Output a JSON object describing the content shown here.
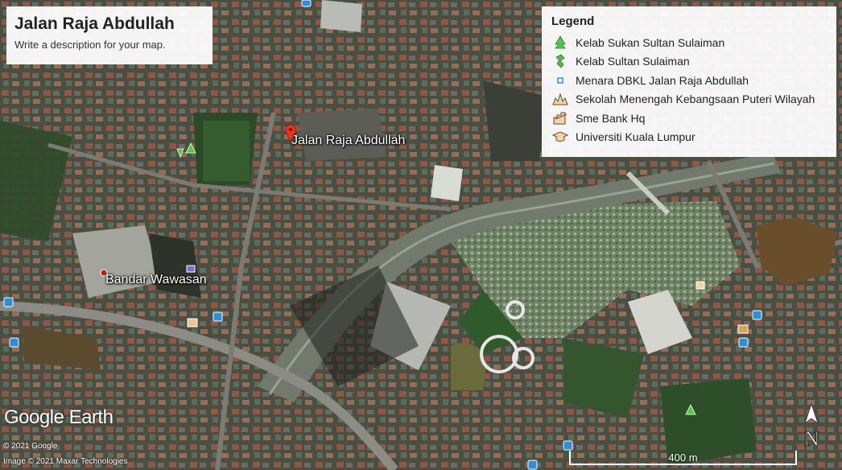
{
  "title": "Jalan Raja Abdullah",
  "description": "Write a description for your map.",
  "legend": {
    "heading": "Legend",
    "items": [
      {
        "label": "Kelab Sukan Sultan Sulaiman",
        "icon": "tree-icon"
      },
      {
        "label": "Kelab Sultan Sulaiman",
        "icon": "sports-icon"
      },
      {
        "label": "Menara DBKL Jalan Raja Abdullah",
        "icon": "square-marker-icon"
      },
      {
        "label": "Sekolah Menengah Kebangsaan Puteri Wilayah",
        "icon": "school-icon"
      },
      {
        "label": "Sme Bank Hq",
        "icon": "bank-icon"
      },
      {
        "label": "Universiti Kuala Lumpur",
        "icon": "graduation-cap-icon"
      }
    ]
  },
  "places": {
    "main_pin": "Jalan Raja Abdullah",
    "second_pin": "Bandar Wawasan"
  },
  "brand": {
    "google": "Google",
    "earth": "Earth"
  },
  "credits": {
    "line1": "© 2021 Google",
    "line2": "Image © 2021 Maxar Technologies"
  },
  "scale_label": "400 m",
  "compass_label": "N",
  "colors": {
    "pin": "#e8331c",
    "tree": "#55c84a",
    "transit": "#2e8fd6"
  }
}
